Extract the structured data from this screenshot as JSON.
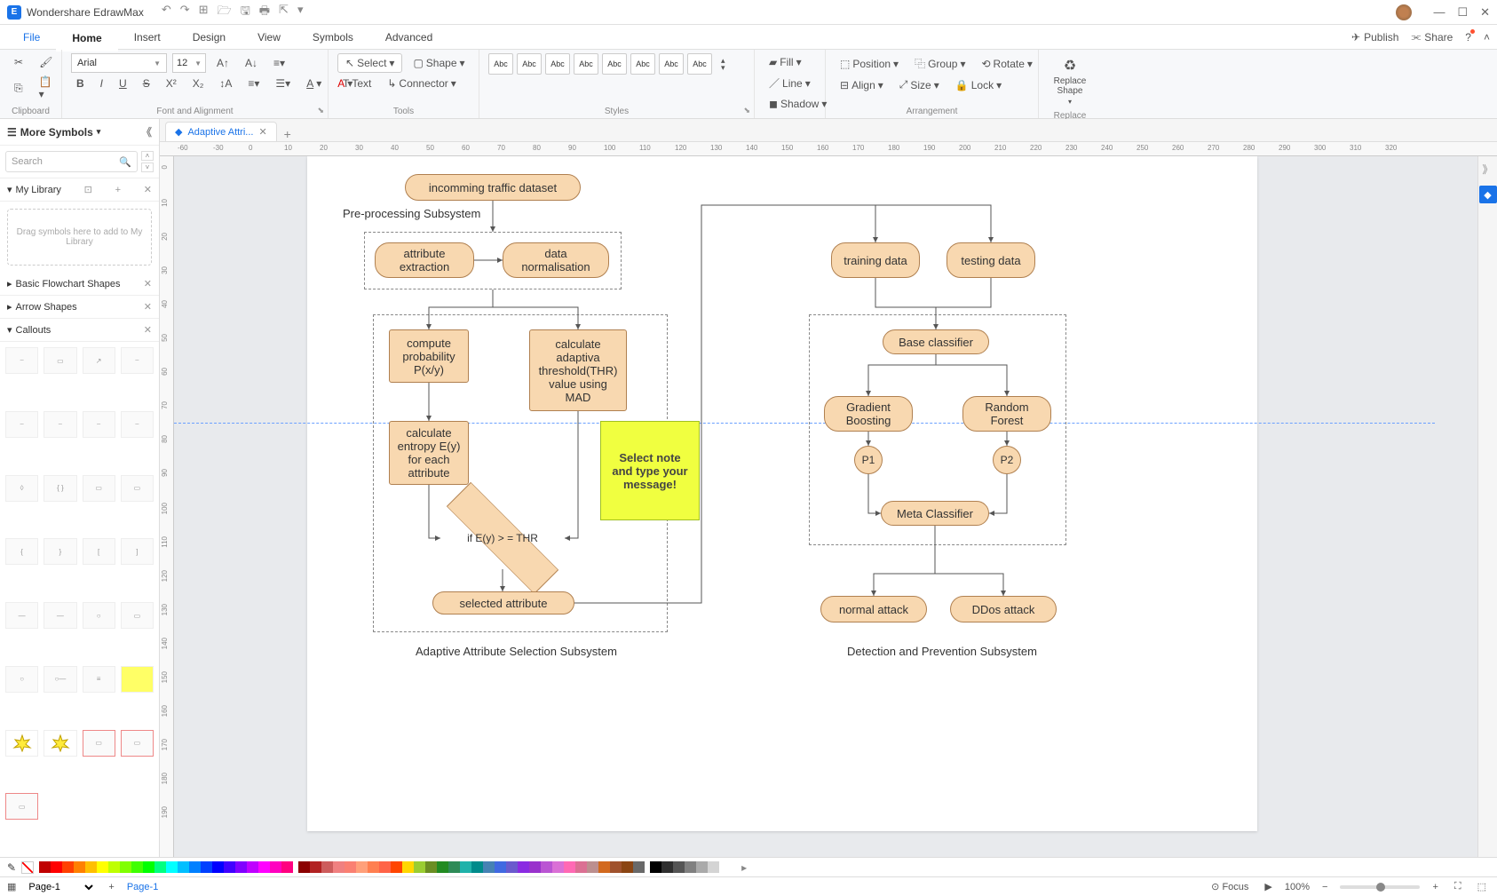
{
  "app": {
    "title": "Wondershare EdrawMax"
  },
  "menu": {
    "file": "File",
    "home": "Home",
    "insert": "Insert",
    "design": "Design",
    "view": "View",
    "symbols": "Symbols",
    "advanced": "Advanced",
    "publish": "Publish",
    "share": "Share"
  },
  "ribbon": {
    "clipboard_label": "Clipboard",
    "font_label": "Font and Alignment",
    "font_name": "Arial",
    "font_size": "12",
    "tools_label": "Tools",
    "select": "Select",
    "shape": "Shape",
    "text": "Text",
    "connector": "Connector",
    "styles_label": "Styles",
    "abc": "Abc",
    "fill": "Fill",
    "line": "Line",
    "shadow": "Shadow",
    "arrangement_label": "Arrangement",
    "position": "Position",
    "group": "Group",
    "rotate": "Rotate",
    "align": "Align",
    "size": "Size",
    "lock": "Lock",
    "replace_label": "Replace",
    "replace_shape": "Replace Shape"
  },
  "left": {
    "more_symbols": "More Symbols",
    "search_placeholder": "Search",
    "my_library": "My Library",
    "lib_drop": "Drag symbols here to add to My Library",
    "basic_flow": "Basic Flowchart Shapes",
    "arrow_shapes": "Arrow Shapes",
    "callouts": "Callouts"
  },
  "tabs": {
    "doc": "Adaptive Attri..."
  },
  "ruler_marks": [
    "-60",
    "-30",
    "0",
    "10",
    "20",
    "30",
    "40",
    "50",
    "60",
    "70",
    "80",
    "90",
    "100",
    "110",
    "120",
    "130",
    "140",
    "150",
    "160",
    "170",
    "180",
    "190",
    "200",
    "210",
    "220",
    "230",
    "240",
    "250",
    "260",
    "270",
    "280",
    "290",
    "300",
    "310",
    "320"
  ],
  "ruler_v": [
    "0",
    "10",
    "20",
    "30",
    "40",
    "50",
    "60",
    "70",
    "80",
    "90",
    "100",
    "110",
    "120",
    "130",
    "140",
    "150",
    "160",
    "170",
    "180",
    "190"
  ],
  "flow": {
    "incoming": "incomming traffic dataset",
    "preproc_label": "Pre-processing Subsystem",
    "attr_ext": "attribute extraction",
    "data_norm": "data normalisation",
    "compute_prob": "compute probability P(x/y)",
    "calc_thr": "calculate adaptiva threshold(THR) value using MAD",
    "calc_entropy": "calculate entropy E(y) for each attribute",
    "decision": "if E(y) > = THR",
    "selected_attr": "selected attribute",
    "adaptive_label": "Adaptive Attribute Selection Subsystem",
    "note": "Select note and type your message!",
    "training": "training data",
    "testing": "testing data",
    "base": "Base classifier",
    "grad": "Gradient Boosting",
    "rf": "Random Forest",
    "p1": "P1",
    "p2": "P2",
    "meta": "Meta Classifier",
    "normal": "normal attack",
    "ddos": "DDos attack",
    "detect_label": "Detection and Prevention Subsystem"
  },
  "status": {
    "page_sel": "Page-1",
    "page_tab": "Page-1",
    "focus": "Focus",
    "zoom": "100%"
  }
}
